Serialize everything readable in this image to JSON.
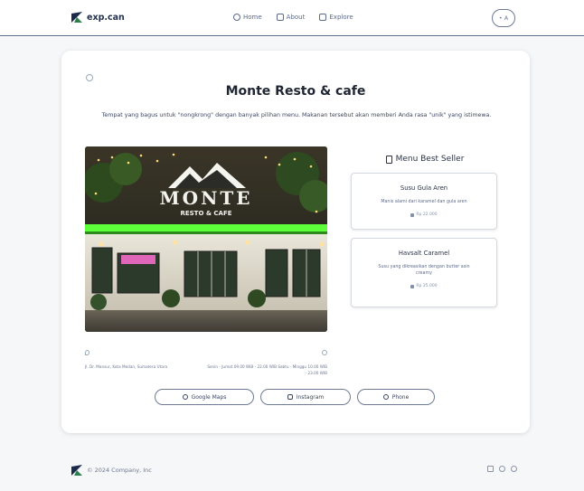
{
  "header": {
    "brand": "exp.can",
    "nav": [
      {
        "label": "Home",
        "icon": "home-icon"
      },
      {
        "label": "About",
        "icon": "info-icon"
      },
      {
        "label": "Explore",
        "icon": "explore-icon"
      }
    ],
    "lang": "• A"
  },
  "main": {
    "title": "Monte Resto & cafe",
    "description": "Tempat yang bagus untuk \"nongkrong\" dengan banyak pilihan menu. Makanan tersebut akan memberi Anda rasa \"unik\" yang istimewa.",
    "photo_alt_text": "MONTE RESTO & CAFE",
    "best_seller": {
      "heading": "Menu Best Seller",
      "items": [
        {
          "name": "Susu Gula Aren",
          "description": "Manis alami dari karamel dan gula aren",
          "price": "Rp 22.000"
        },
        {
          "name": "Havsalt Caramel",
          "description": "Susu yang dikreasikan dengan butter asin creamy",
          "price": "Rp 25.000"
        }
      ]
    },
    "address": "Jl. Dr. Mansur, Kota Medan, Sumatera Utara",
    "hours": "Senin - Jumat 09.00 WIB - 22.00 WIB Sabtu - Minggu 10.00 WIB - 23.00 WIB",
    "buttons": [
      {
        "label": "Google Maps",
        "icon": "map-pin-icon"
      },
      {
        "label": "Instagram",
        "icon": "instagram-icon"
      },
      {
        "label": "Phone",
        "icon": "phone-icon"
      }
    ]
  },
  "footer": {
    "copyright": "© 2024 Company, Inc",
    "icons": [
      "instagram-icon",
      "facebook-icon",
      "whatsapp-icon"
    ]
  },
  "colors": {
    "accent": "#24324f",
    "header_line": "#5a6a8c",
    "sign_green": "#5cff3a"
  }
}
